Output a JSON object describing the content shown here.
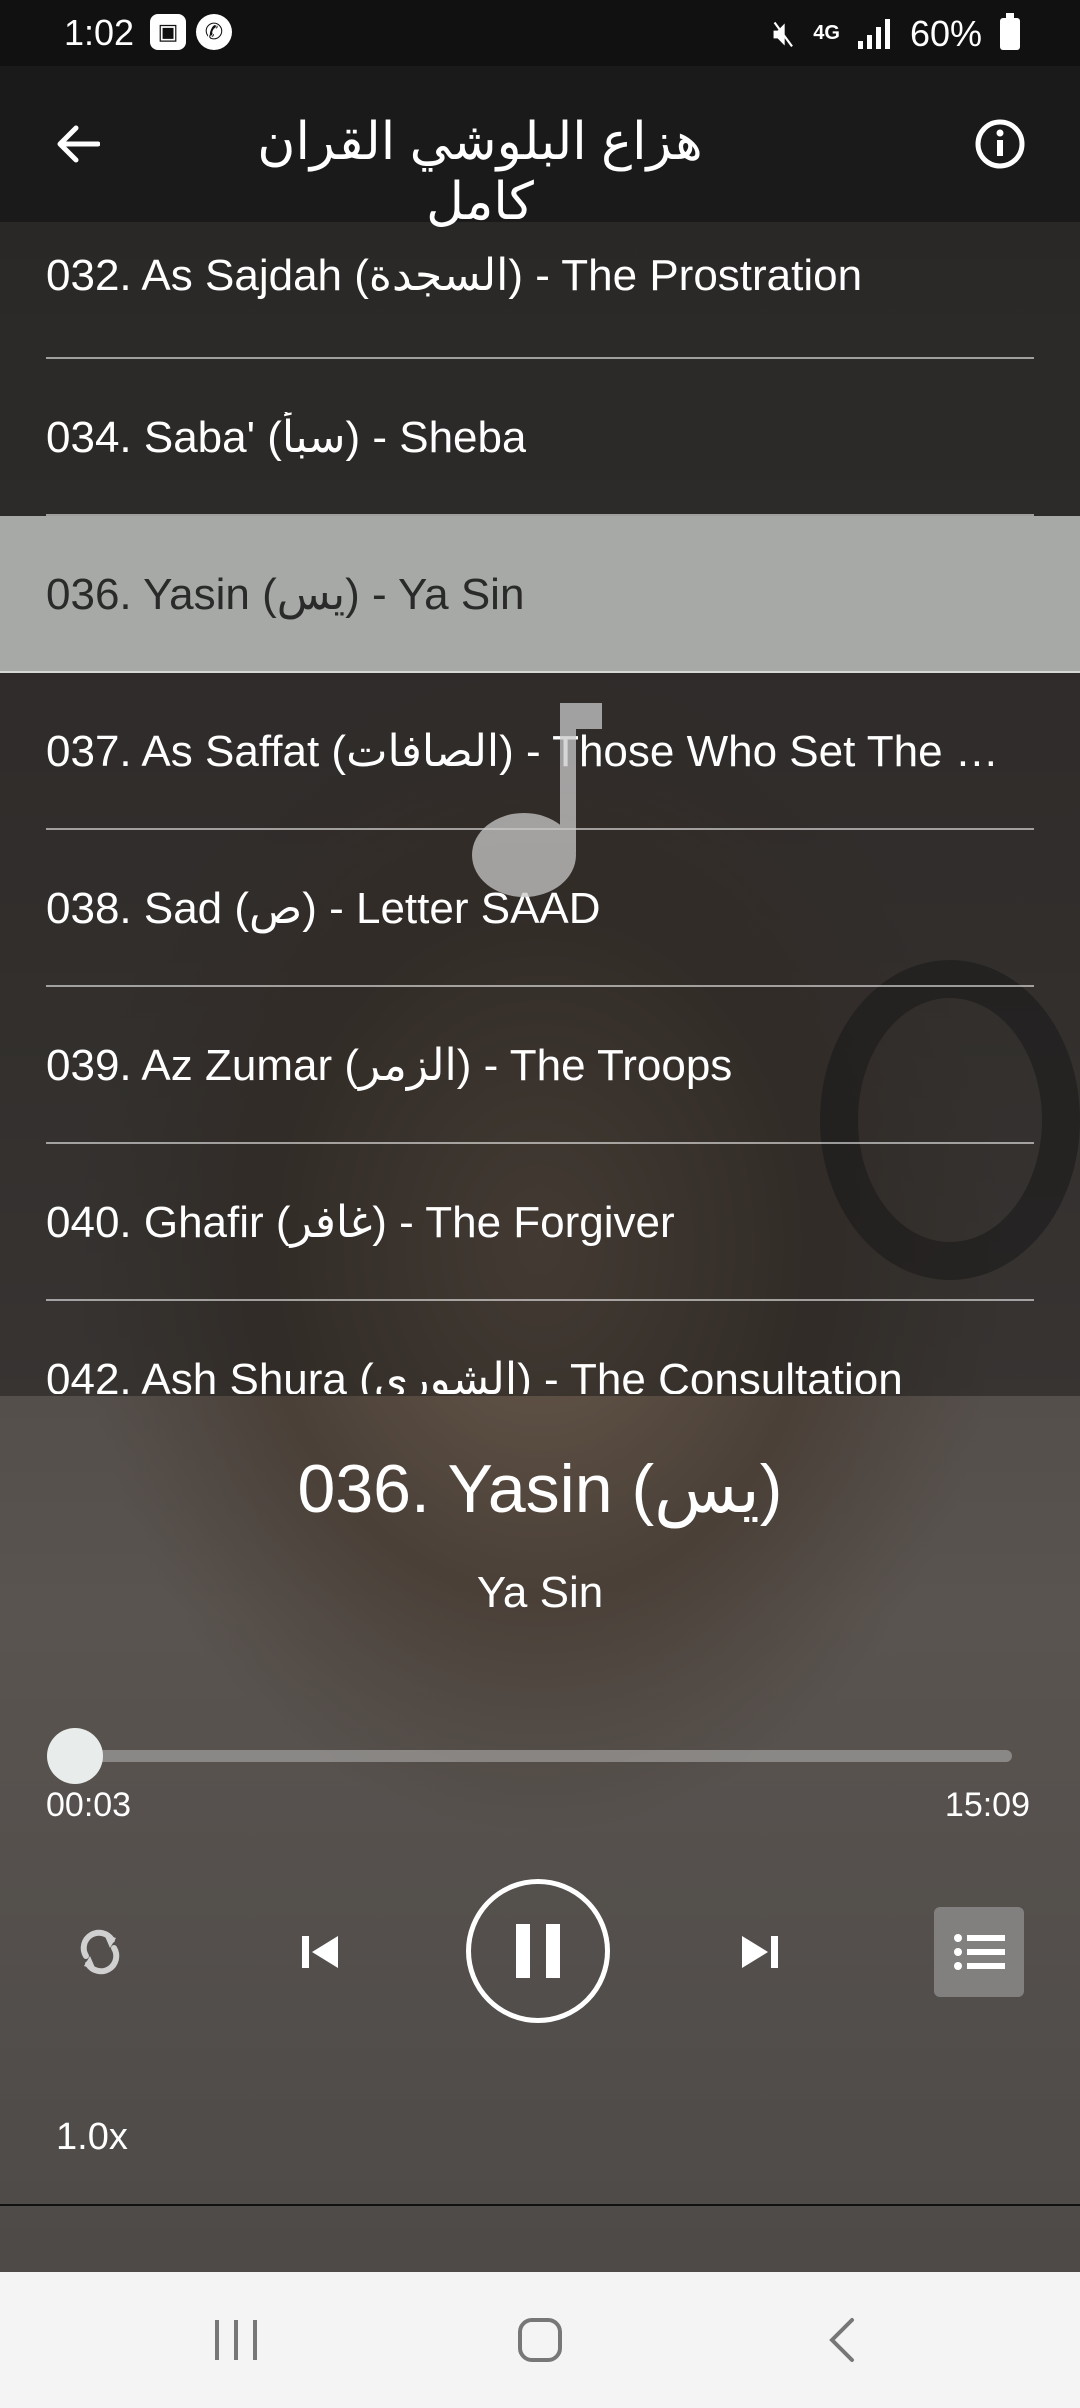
{
  "status_bar": {
    "time": "1:02",
    "network": "4G",
    "battery": "60%"
  },
  "app_bar": {
    "title": "هزاع البلوشي القران كامل"
  },
  "playlist": [
    {
      "label": "032. As Sajdah (السجدة) - The Prostration",
      "selected": false
    },
    {
      "label": "034. Saba' (سبأ) - Sheba",
      "selected": false
    },
    {
      "label": "036. Yasin (يس) - Ya Sin",
      "selected": true
    },
    {
      "label": "037. As Saffat (الصافات) - Those Who Set The Ra...",
      "selected": false
    },
    {
      "label": "038. Sad (ص) - Letter SAAD",
      "selected": false
    },
    {
      "label": "039. Az Zumar (الزمر) - The Troops",
      "selected": false
    },
    {
      "label": "040. Ghafir (غافر) - The Forgiver",
      "selected": false
    },
    {
      "label": "042. Ash Shura (الشورى) - The Consultation",
      "selected": false
    }
  ],
  "now_playing": {
    "title": "036. Yasin (يس)",
    "subtitle": "Ya Sin",
    "elapsed": "00:03",
    "duration": "15:09",
    "progress_fraction": 0.003,
    "speed": "1.0x"
  },
  "icons": {
    "back": "arrow-left-icon",
    "info": "info-icon",
    "repeat": "repeat-icon",
    "previous": "skip-previous-icon",
    "pause": "pause-icon",
    "next": "skip-next-icon",
    "queue": "playlist-icon"
  },
  "colors": {
    "app_bar": "#1a1a1a",
    "selected_row": "#c8cdc8",
    "nav_bar": "#f4f4f4"
  }
}
